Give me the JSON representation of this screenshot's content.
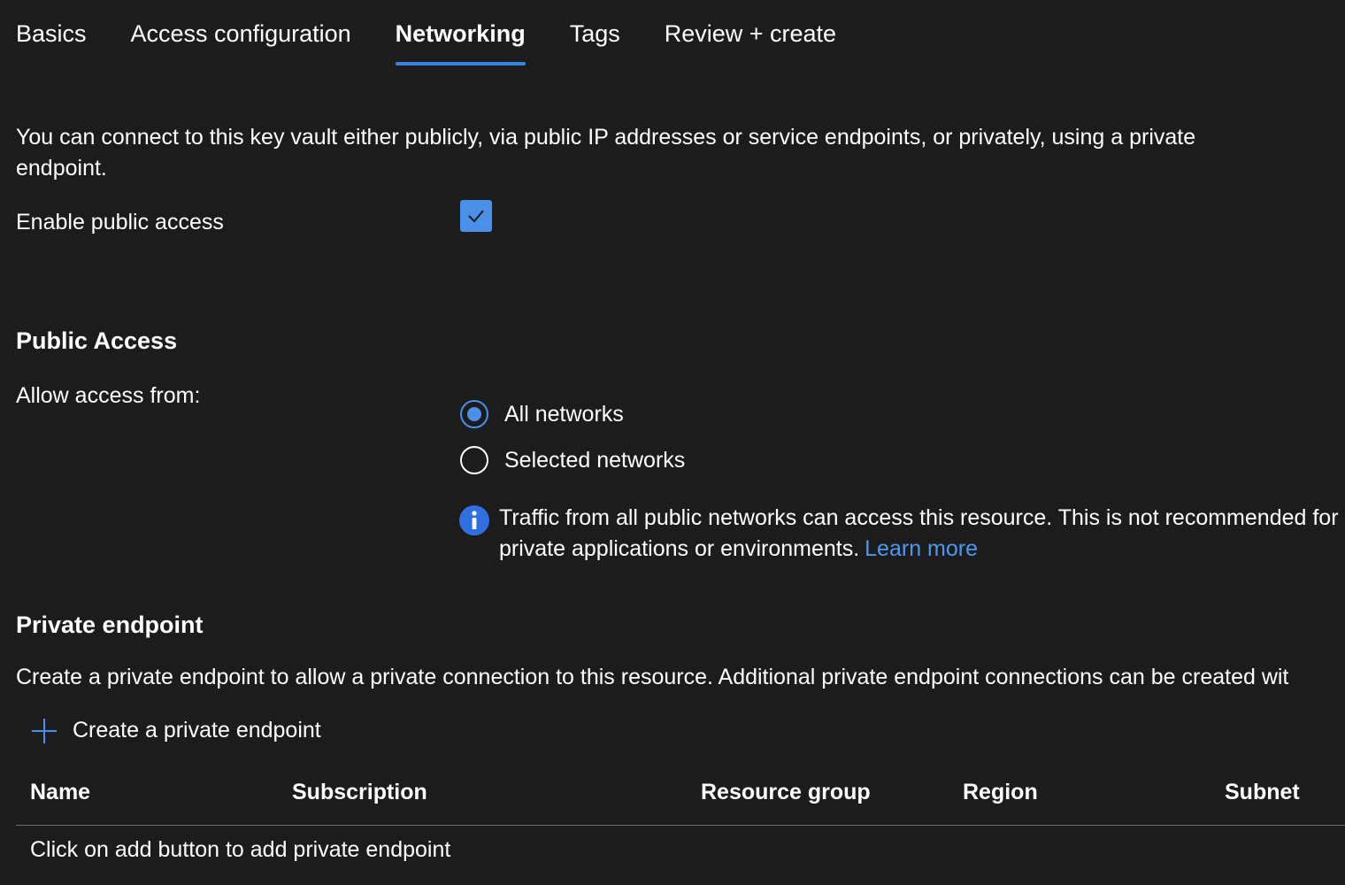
{
  "tabs": [
    {
      "label": "Basics",
      "active": false
    },
    {
      "label": "Access configuration",
      "active": false
    },
    {
      "label": "Networking",
      "active": true
    },
    {
      "label": "Tags",
      "active": false
    },
    {
      "label": "Review + create",
      "active": false
    }
  ],
  "intro_text": "You can connect to this key vault either publicly, via public IP addresses or service endpoints, or privately, using a private endpoint.",
  "public_access_toggle": {
    "label": "Enable public access",
    "checked": true
  },
  "public_access": {
    "title": "Public Access",
    "allow_label": "Allow access from:",
    "options": [
      {
        "label": "All networks",
        "selected": true
      },
      {
        "label": "Selected networks",
        "selected": false
      }
    ],
    "info_text": "Traffic from all public networks can access this resource. This is not recommended for private applications or environments.",
    "learn_more": "Learn more"
  },
  "private_endpoint": {
    "title": "Private endpoint",
    "description": "Create a private endpoint to allow a private connection to this resource. Additional private endpoint connections can be created wit",
    "create_label": "Create a private endpoint",
    "columns": [
      "Name",
      "Subscription",
      "Resource group",
      "Region",
      "Subnet"
    ],
    "empty_text": "Click on add button to add private endpoint"
  },
  "colors": {
    "background": "#1c1c1c",
    "accent": "#4a90e8",
    "link": "#4a9af0",
    "info_icon": "#2f6fe0"
  },
  "icons": {
    "checkbox": "checkmark-icon",
    "info": "info-icon",
    "create": "plus-icon"
  }
}
